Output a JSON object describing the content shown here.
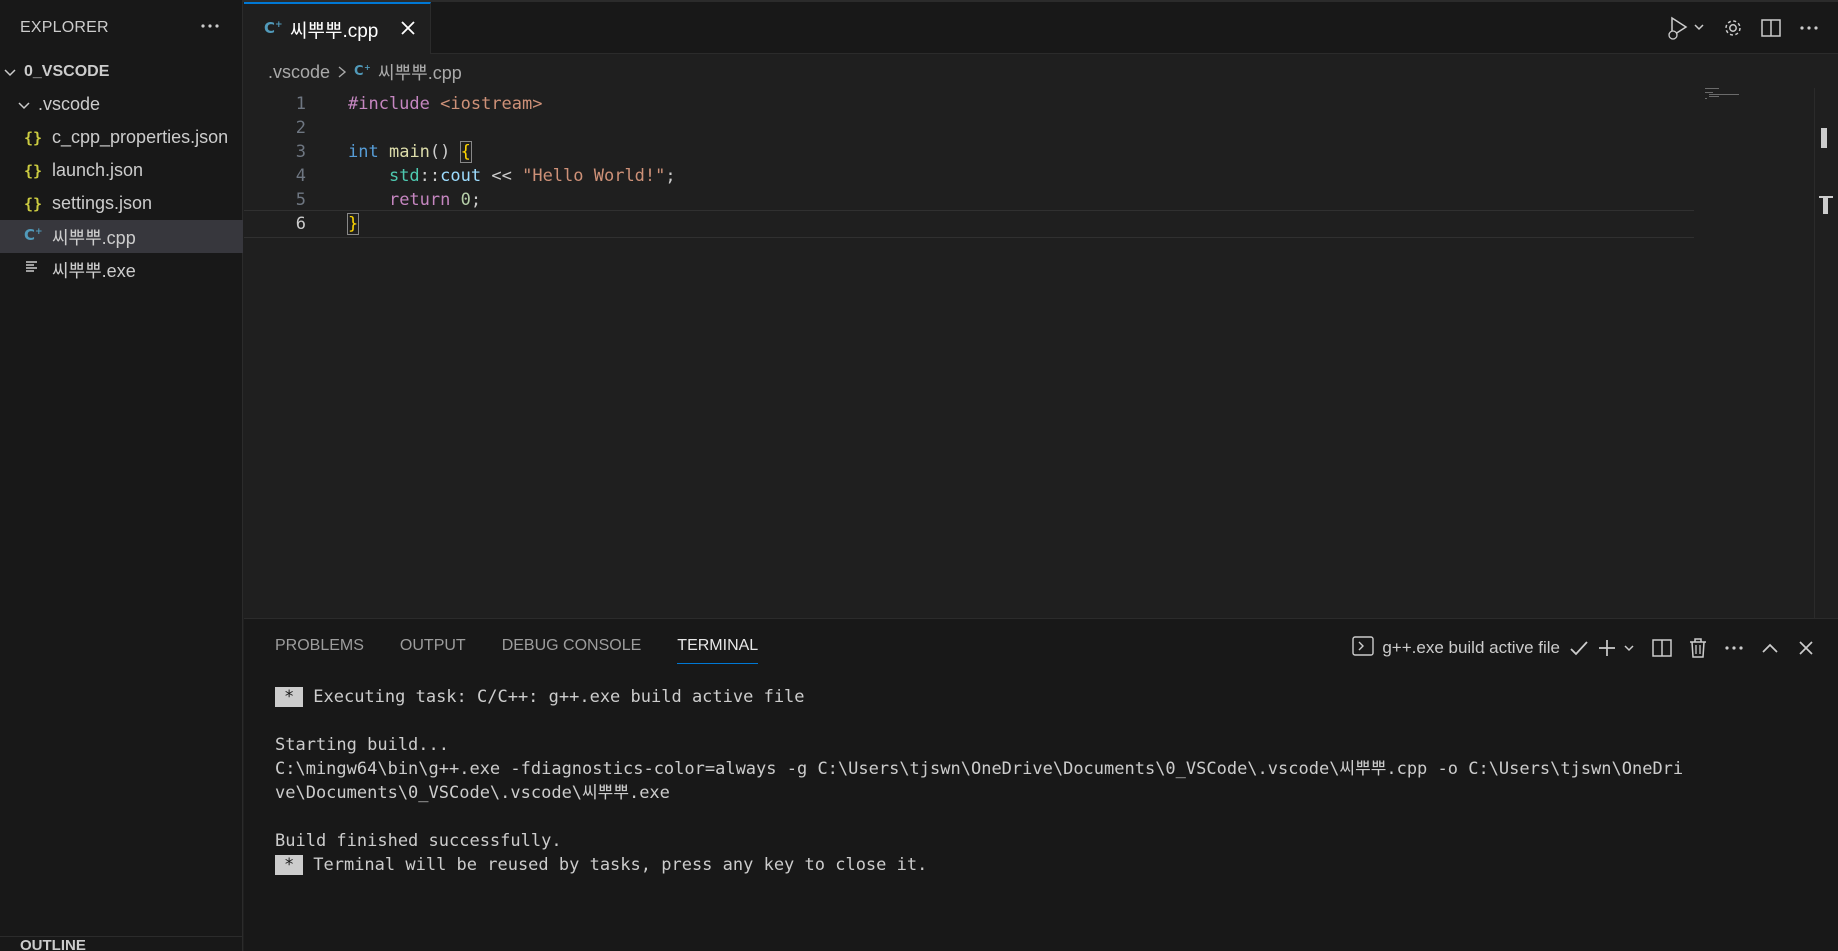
{
  "sidebar": {
    "title": "EXPLORER",
    "root": "0_VSCODE",
    "folder": ".vscode",
    "files": [
      {
        "label": "c_cpp_properties.json",
        "type": "json"
      },
      {
        "label": "launch.json",
        "type": "json"
      },
      {
        "label": "settings.json",
        "type": "json"
      },
      {
        "label": "씨뿌뿌.cpp",
        "type": "cpp",
        "selected": true
      },
      {
        "label": "씨뿌뿌.exe",
        "type": "exe"
      }
    ],
    "outline": "OUTLINE"
  },
  "tab": {
    "label": "씨뿌뿌.cpp"
  },
  "breadcrumb": {
    "folder": ".vscode",
    "file": "씨뿌뿌.cpp"
  },
  "editor": {
    "line_numbers": [
      "1",
      "2",
      "3",
      "4",
      "5",
      "6"
    ],
    "active_line": 6,
    "code": {
      "l1_directive": "#include",
      "l1_header": "<iostream>",
      "l3_type": "int",
      "l3_fn": "main",
      "l3_parens": "()",
      "l3_brace": "{",
      "l4_ns": "std",
      "l4_colon": "::",
      "l4_var": "cout",
      "l4_op": "<<",
      "l4_str": "\"Hello World!\"",
      "l4_semi": ";",
      "l5_kw": "return",
      "l5_num": "0",
      "l5_semi": ";",
      "l6_brace": "}"
    }
  },
  "panel": {
    "tabs": [
      "PROBLEMS",
      "OUTPUT",
      "DEBUG CONSOLE",
      "TERMINAL"
    ],
    "active_tab": "TERMINAL",
    "terminal_name": "g++.exe build active file",
    "terminal": {
      "star": "*",
      "line1": "Executing task: C/C++: g++.exe build active file",
      "line2": "Starting build...",
      "line3": "C:\\mingw64\\bin\\g++.exe -fdiagnostics-color=always -g C:\\Users\\tjswn\\OneDrive\\Documents\\0_VSCode\\.vscode\\씨뿌뿌.cpp -o C:\\Users\\tjswn\\OneDri",
      "line4": "ve\\Documents\\0_VSCode\\.vscode\\씨뿌뿌.exe",
      "line5": "Build finished successfully.",
      "line6": "Terminal will be reused by tasks, press any key to close it."
    }
  },
  "colors": {
    "accent": "#0078d4",
    "json_icon": "#cbcb41",
    "cpp_icon": "#519aba"
  }
}
